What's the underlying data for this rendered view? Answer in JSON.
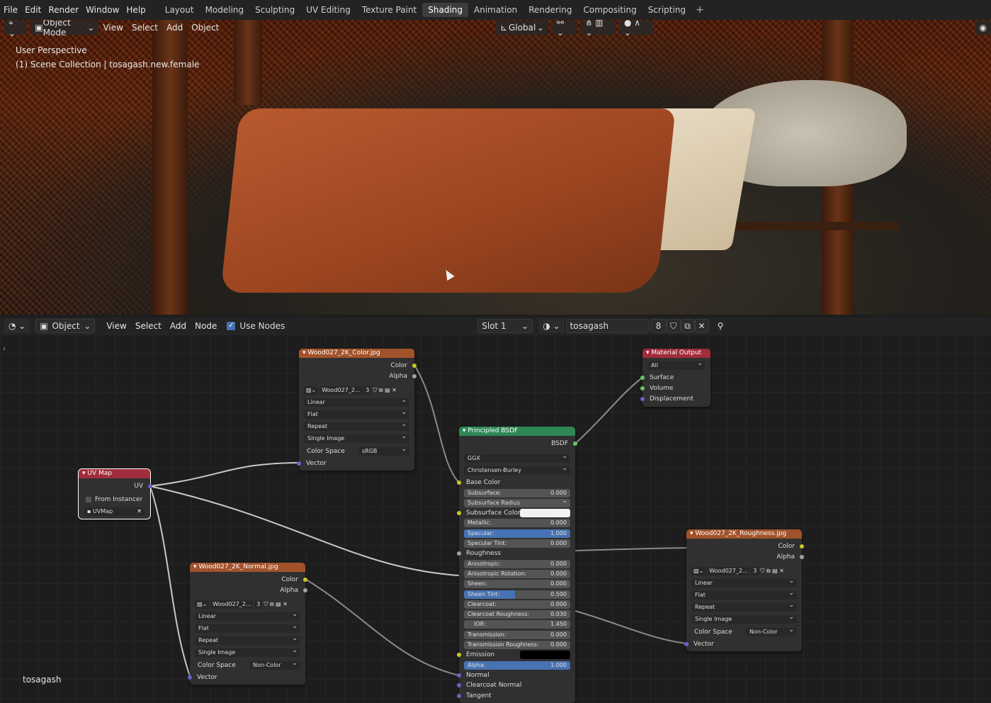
{
  "menu": [
    "File",
    "Edit",
    "Render",
    "Window",
    "Help"
  ],
  "workspaces": [
    "Layout",
    "Modeling",
    "Sculpting",
    "UV Editing",
    "Texture Paint",
    "Shading",
    "Animation",
    "Rendering",
    "Compositing",
    "Scripting"
  ],
  "active_workspace": "Shading",
  "viewport": {
    "mode": "Object Mode",
    "menus": [
      "View",
      "Select",
      "Add",
      "Object"
    ],
    "transform": "Global",
    "info_line1": "User Perspective",
    "info_line2": "(1) Scene Collection | tosagash.new.female"
  },
  "node_header": {
    "mode": "Object",
    "menus": [
      "View",
      "Select",
      "Add",
      "Node"
    ],
    "use_nodes": "Use Nodes",
    "slot": "Slot 1",
    "material": "tosagash",
    "users": "8"
  },
  "object_label": "tosagash",
  "nodes": {
    "color_tex": {
      "title": "Wood027_2K_Color.jpg",
      "out1": "Color",
      "out2": "Alpha",
      "img": "Wood027_2...",
      "users": "3",
      "interp": "Linear",
      "proj": "Flat",
      "ext": "Repeat",
      "src": "Single Image",
      "cs_label": "Color Space",
      "cs": "sRGB",
      "vec": "Vector"
    },
    "uvmap": {
      "title": "UV Map",
      "out": "UV",
      "from_inst": "From Instancer",
      "map": "UVMap"
    },
    "normal_tex": {
      "title": "Wood027_2K_Normal.jpg",
      "out1": "Color",
      "out2": "Alpha",
      "img": "Wood027_2...",
      "users": "3",
      "interp": "Linear",
      "proj": "Flat",
      "ext": "Repeat",
      "src": "Single Image",
      "cs_label": "Color Space",
      "cs": "Non-Color",
      "vec": "Vector"
    },
    "rough_tex": {
      "title": "Wood027_2K_Roughness.jpg",
      "out1": "Color",
      "out2": "Alpha",
      "img": "Wood027_2...",
      "users": "3",
      "interp": "Linear",
      "proj": "Flat",
      "ext": "Repeat",
      "src": "Single Image",
      "cs_label": "Color Space",
      "cs": "Non-Color",
      "vec": "Vector"
    },
    "output": {
      "title": "Material Output",
      "target": "All",
      "surface": "Surface",
      "volume": "Volume",
      "disp": "Displacement"
    },
    "bsdf": {
      "title": "Principled BSDF",
      "out": "BSDF",
      "dist": "GGX",
      "sss": "Christensen-Burley",
      "base_color": "Base Color",
      "subsurface": [
        "Subsurface:",
        "0.000"
      ],
      "subsurface_radius": "Subsurface Radius",
      "subsurface_color": "Subsurface Color",
      "metallic": [
        "Metallic:",
        "0.000"
      ],
      "specular": [
        "Specular:",
        "1.000"
      ],
      "specular_tint": [
        "Specular Tint:",
        "0.000"
      ],
      "roughness": "Roughness",
      "anisotropic": [
        "Anisotropic:",
        "0.000"
      ],
      "aniso_rot": [
        "Anisotropic Rotation:",
        "0.000"
      ],
      "sheen": [
        "Sheen:",
        "0.000"
      ],
      "sheen_tint": [
        "Sheen Tint:",
        "0.500"
      ],
      "clearcoat": [
        "Clearcoat:",
        "0.000"
      ],
      "clearcoat_rough": [
        "Clearcoat Roughness:",
        "0.030"
      ],
      "ior": [
        "IOR:",
        "1.450"
      ],
      "transmission": [
        "Transmission:",
        "0.000"
      ],
      "trans_rough": [
        "Transmission Roughness:",
        "0.000"
      ],
      "emission": "Emission",
      "alpha": [
        "Alpha:",
        "1.000"
      ],
      "normal": "Normal",
      "cc_normal": "Clearcoat Normal",
      "tangent": "Tangent"
    }
  },
  "colors": {
    "accent": "#4772b3",
    "tex_header": "#a2522a",
    "shader_header": "#2d8855",
    "input_header": "#a12c3c"
  }
}
